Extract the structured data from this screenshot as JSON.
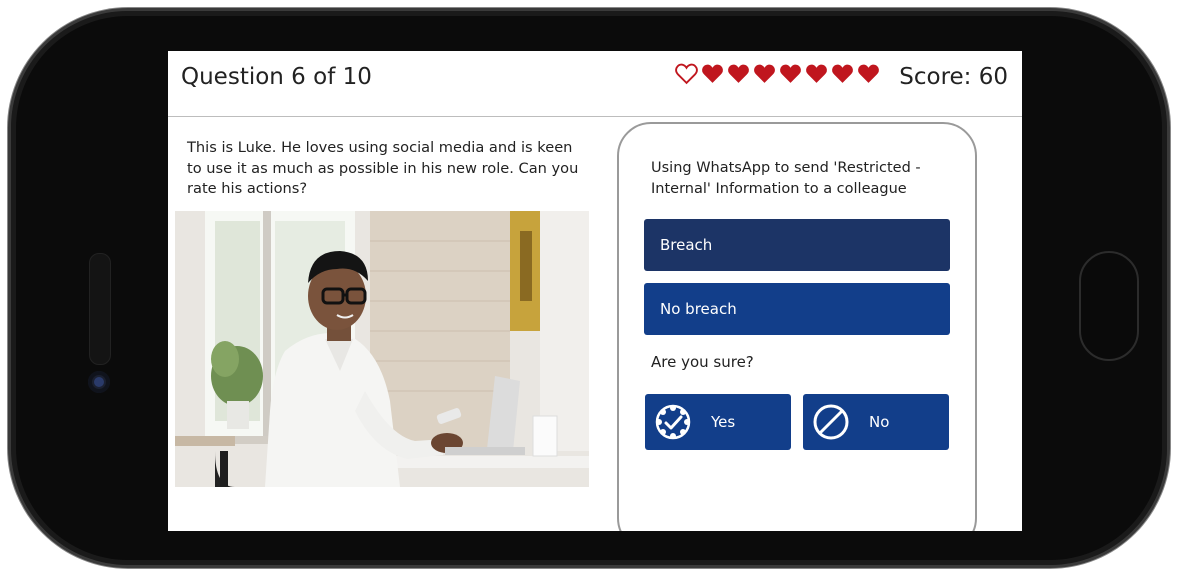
{
  "header": {
    "question_label": "Question 6 of 10",
    "score_label": "Score: 60",
    "lives": {
      "total": 8,
      "lost": 1
    }
  },
  "prompt": "This is Luke. He loves using social media and is keen to use it as much as possible in his new role. Can you rate his actions?",
  "card": {
    "scenario": "Using WhatsApp to send 'Restricted - Internal' Information to a colleague",
    "options": [
      "Breach",
      "No breach"
    ],
    "confirm_question": "Are you sure?",
    "yes_label": "Yes",
    "no_label": "No"
  },
  "colors": {
    "heart": "#c0161e",
    "button_dark": "#1c3466",
    "button_primary": "#123e8a"
  }
}
